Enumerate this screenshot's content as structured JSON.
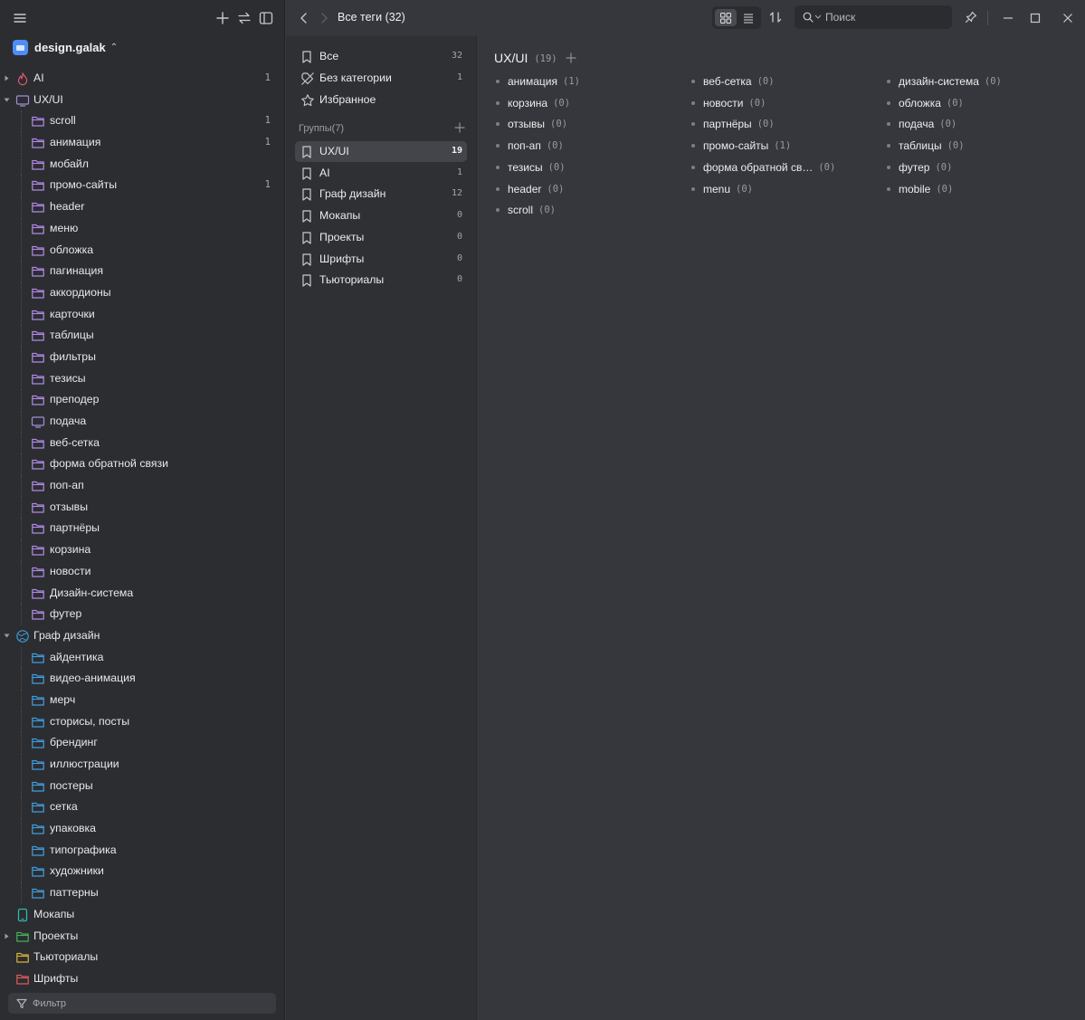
{
  "library": {
    "name": "design.galak"
  },
  "sidebar": {
    "filter_placeholder": "Фильтр",
    "tree": [
      {
        "label": "AI",
        "count": "1",
        "level": 0,
        "icon": "flame-icon",
        "color": "#e0566b",
        "arrow": "right"
      },
      {
        "label": "UX/UI",
        "count": "",
        "level": 0,
        "icon": "monitor-icon",
        "color": "#a58bd9",
        "arrow": "down"
      },
      {
        "label": "scroll",
        "count": "1",
        "level": 1,
        "icon": "folder-icon",
        "color": "#b18ae6"
      },
      {
        "label": "анимация",
        "count": "1",
        "level": 1,
        "icon": "folder-icon",
        "color": "#b18ae6"
      },
      {
        "label": "мобайл",
        "count": "",
        "level": 1,
        "icon": "folder-icon",
        "color": "#b18ae6"
      },
      {
        "label": "промо-сайты",
        "count": "1",
        "level": 1,
        "icon": "folder-icon",
        "color": "#b18ae6"
      },
      {
        "label": "header",
        "count": "",
        "level": 1,
        "icon": "folder-icon",
        "color": "#b18ae6"
      },
      {
        "label": "меню",
        "count": "",
        "level": 1,
        "icon": "folder-icon",
        "color": "#b18ae6"
      },
      {
        "label": "обложка",
        "count": "",
        "level": 1,
        "icon": "folder-icon",
        "color": "#b18ae6"
      },
      {
        "label": "пагинация",
        "count": "",
        "level": 1,
        "icon": "folder-icon",
        "color": "#b18ae6"
      },
      {
        "label": "аккордионы",
        "count": "",
        "level": 1,
        "icon": "folder-icon",
        "color": "#b18ae6"
      },
      {
        "label": "карточки",
        "count": "",
        "level": 1,
        "icon": "folder-icon",
        "color": "#b18ae6"
      },
      {
        "label": "таблицы",
        "count": "",
        "level": 1,
        "icon": "folder-icon",
        "color": "#b18ae6"
      },
      {
        "label": "фильтры",
        "count": "",
        "level": 1,
        "icon": "folder-icon",
        "color": "#b18ae6"
      },
      {
        "label": "тезисы",
        "count": "",
        "level": 1,
        "icon": "folder-icon",
        "color": "#b18ae6"
      },
      {
        "label": "преподер",
        "count": "",
        "level": 1,
        "icon": "folder-icon",
        "color": "#b18ae6"
      },
      {
        "label": "подача",
        "count": "",
        "level": 1,
        "icon": "monitor-icon",
        "color": "#a58bd9"
      },
      {
        "label": "веб-сетка",
        "count": "",
        "level": 1,
        "icon": "folder-icon",
        "color": "#b18ae6"
      },
      {
        "label": "форма обратной связи",
        "count": "",
        "level": 1,
        "icon": "folder-icon",
        "color": "#b18ae6"
      },
      {
        "label": "поп-ап",
        "count": "",
        "level": 1,
        "icon": "folder-icon",
        "color": "#b18ae6"
      },
      {
        "label": "отзывы",
        "count": "",
        "level": 1,
        "icon": "folder-icon",
        "color": "#b18ae6"
      },
      {
        "label": "партнёры",
        "count": "",
        "level": 1,
        "icon": "folder-icon",
        "color": "#b18ae6"
      },
      {
        "label": "корзина",
        "count": "",
        "level": 1,
        "icon": "folder-icon",
        "color": "#b18ae6"
      },
      {
        "label": "новости",
        "count": "",
        "level": 1,
        "icon": "folder-icon",
        "color": "#b18ae6"
      },
      {
        "label": "Дизайн-система",
        "count": "",
        "level": 1,
        "icon": "folder-icon",
        "color": "#b18ae6"
      },
      {
        "label": "футер",
        "count": "",
        "level": 1,
        "icon": "folder-icon",
        "color": "#b18ae6"
      },
      {
        "label": "Граф дизайн",
        "count": "",
        "level": 0,
        "icon": "globe-icon",
        "color": "#3a9ad9",
        "arrow": "down"
      },
      {
        "label": "айдентика",
        "count": "",
        "level": 1,
        "icon": "folder-icon",
        "color": "#3f9ee0"
      },
      {
        "label": "видео-анимация",
        "count": "",
        "level": 1,
        "icon": "folder-icon",
        "color": "#3f9ee0"
      },
      {
        "label": "мерч",
        "count": "",
        "level": 1,
        "icon": "folder-icon",
        "color": "#3f9ee0"
      },
      {
        "label": "сторисы, посты",
        "count": "",
        "level": 1,
        "icon": "folder-icon",
        "color": "#3f9ee0"
      },
      {
        "label": "брендинг",
        "count": "",
        "level": 1,
        "icon": "folder-icon",
        "color": "#3f9ee0"
      },
      {
        "label": "иллюстрации",
        "count": "",
        "level": 1,
        "icon": "folder-icon",
        "color": "#3f9ee0"
      },
      {
        "label": "постеры",
        "count": "",
        "level": 1,
        "icon": "folder-icon",
        "color": "#3f9ee0"
      },
      {
        "label": "сетка",
        "count": "",
        "level": 1,
        "icon": "folder-icon",
        "color": "#3f9ee0"
      },
      {
        "label": "упаковка",
        "count": "",
        "level": 1,
        "icon": "folder-icon",
        "color": "#3f9ee0"
      },
      {
        "label": "типографика",
        "count": "",
        "level": 1,
        "icon": "folder-icon",
        "color": "#3f9ee0"
      },
      {
        "label": "художники",
        "count": "",
        "level": 1,
        "icon": "folder-icon",
        "color": "#3f9ee0"
      },
      {
        "label": "паттерны",
        "count": "",
        "level": 1,
        "icon": "folder-icon",
        "color": "#3f9ee0"
      },
      {
        "label": "Мокапы",
        "count": "",
        "level": 0,
        "icon": "phone-icon",
        "color": "#2fb8a6"
      },
      {
        "label": "Проекты",
        "count": "",
        "level": 0,
        "icon": "folder-icon",
        "color": "#3fb35a",
        "arrow": "right"
      },
      {
        "label": "Тьюториалы",
        "count": "",
        "level": 0,
        "icon": "folder-icon",
        "color": "#d9b23a"
      },
      {
        "label": "Шрифты",
        "count": "",
        "level": 0,
        "icon": "folder-icon",
        "color": "#e05a5a"
      }
    ]
  },
  "topbar": {
    "title": "Все теги (32)",
    "search_placeholder": "Поиск"
  },
  "middle": {
    "all": {
      "label": "Все",
      "count": "32"
    },
    "uncategorized": {
      "label": "Без категории",
      "count": "1"
    },
    "favorites": {
      "label": "Избранное"
    },
    "groups_header": "Группы(7)",
    "groups": [
      {
        "label": "UX/UI",
        "count": "19",
        "active": true
      },
      {
        "label": "AI",
        "count": "1"
      },
      {
        "label": "Граф дизайн",
        "count": "12"
      },
      {
        "label": "Мокапы",
        "count": "0"
      },
      {
        "label": "Проекты",
        "count": "0"
      },
      {
        "label": "Шрифты",
        "count": "0"
      },
      {
        "label": "Тьюториалы",
        "count": "0"
      }
    ]
  },
  "main": {
    "group_name": "UX/UI",
    "group_count": "(19)",
    "columns": [
      [
        {
          "name": "анимация",
          "count": "(1)"
        },
        {
          "name": "корзина",
          "count": "(0)"
        },
        {
          "name": "отзывы",
          "count": "(0)"
        },
        {
          "name": "поп-ап",
          "count": "(0)"
        },
        {
          "name": "тезисы",
          "count": "(0)"
        },
        {
          "name": "header",
          "count": "(0)"
        },
        {
          "name": "scroll",
          "count": "(0)"
        }
      ],
      [
        {
          "name": "веб-сетка",
          "count": "(0)"
        },
        {
          "name": "новости",
          "count": "(0)"
        },
        {
          "name": "партнёры",
          "count": "(0)"
        },
        {
          "name": "промо-сайты",
          "count": "(1)"
        },
        {
          "name": "форма обратной св…",
          "count": "(0)"
        },
        {
          "name": "menu",
          "count": "(0)"
        }
      ],
      [
        {
          "name": "дизайн-система",
          "count": "(0)"
        },
        {
          "name": "обложка",
          "count": "(0)"
        },
        {
          "name": "подача",
          "count": "(0)"
        },
        {
          "name": "таблицы",
          "count": "(0)"
        },
        {
          "name": "футер",
          "count": "(0)"
        },
        {
          "name": "mobile",
          "count": "(0)"
        }
      ]
    ]
  },
  "colors": {
    "accent": "#4d8ef5",
    "active_row": "#44454b"
  }
}
